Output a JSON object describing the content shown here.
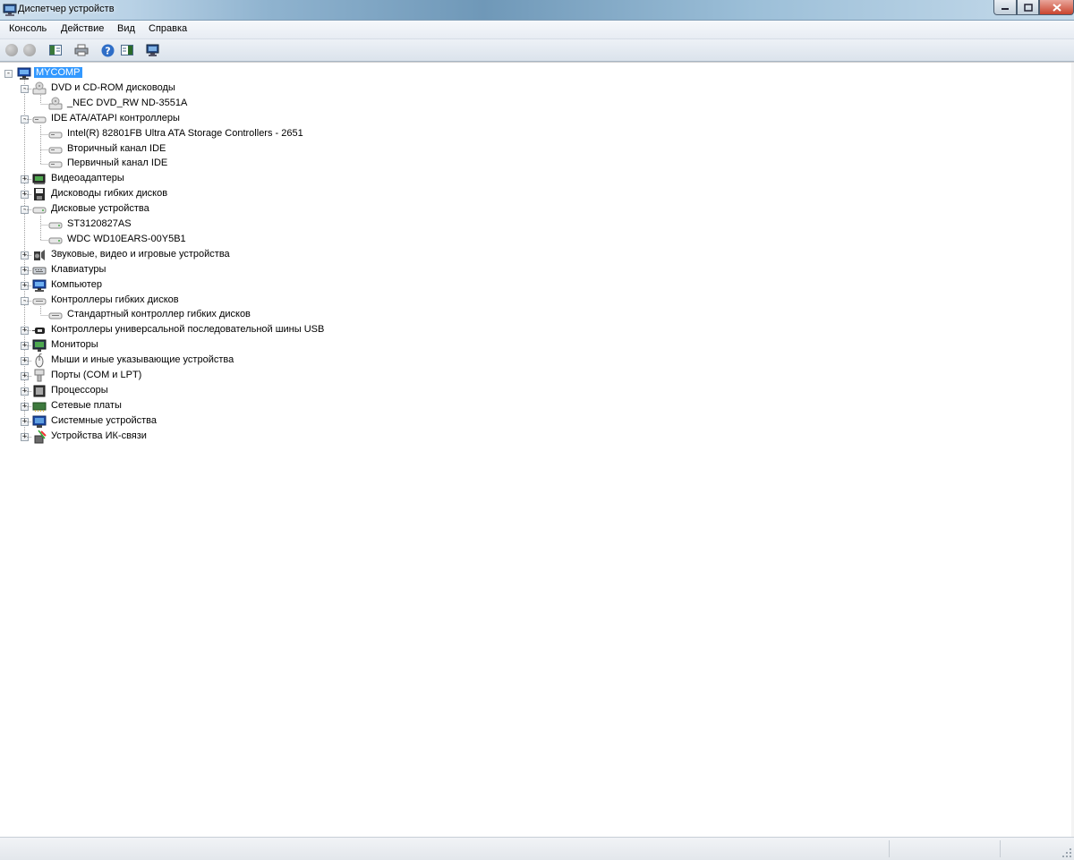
{
  "window": {
    "title": "Диспетчер устройств"
  },
  "menu": [
    "Консоль",
    "Действие",
    "Вид",
    "Справка"
  ],
  "toolbar": [
    "back-icon",
    "forward-icon",
    "show-hide-tree-icon",
    "print-icon",
    "help-icon",
    "action-pane-icon",
    "monitor-icon"
  ],
  "colors": {
    "selection": "#3399ff",
    "accent": "#6f98b8"
  },
  "tree": {
    "root": "MYCOMP",
    "nodes": [
      {
        "label": "DVD и CD-ROM дисководы",
        "level": 1,
        "expander": "-",
        "icon": "cdrom-icon"
      },
      {
        "label": "_NEC DVD_RW ND-3551A",
        "level": 2,
        "expander": "",
        "icon": "cdrom-icon"
      },
      {
        "label": "IDE ATA/ATAPI контроллеры",
        "level": 1,
        "expander": "-",
        "icon": "ide-controller-icon"
      },
      {
        "label": "Intel(R) 82801FB Ultra ATA Storage Controllers - 2651",
        "level": 2,
        "expander": "",
        "icon": "ide-controller-icon"
      },
      {
        "label": "Вторичный канал IDE",
        "level": 2,
        "expander": "",
        "icon": "ide-controller-icon"
      },
      {
        "label": "Первичный канал IDE",
        "level": 2,
        "expander": "",
        "icon": "ide-controller-icon"
      },
      {
        "label": "Видеоадаптеры",
        "level": 1,
        "expander": "+",
        "icon": "display-adapter-icon"
      },
      {
        "label": "Дисководы гибких дисков",
        "level": 1,
        "expander": "+",
        "icon": "floppy-icon"
      },
      {
        "label": "Дисковые устройства",
        "level": 1,
        "expander": "-",
        "icon": "disk-drive-icon"
      },
      {
        "label": "ST3120827AS",
        "level": 2,
        "expander": "",
        "icon": "disk-drive-icon"
      },
      {
        "label": "WDC WD10EARS-00Y5B1",
        "level": 2,
        "expander": "",
        "icon": "disk-drive-icon"
      },
      {
        "label": "Звуковые, видео и игровые устройства",
        "level": 1,
        "expander": "+",
        "icon": "speaker-icon"
      },
      {
        "label": "Клавиатуры",
        "level": 1,
        "expander": "+",
        "icon": "keyboard-icon"
      },
      {
        "label": "Компьютер",
        "level": 1,
        "expander": "+",
        "icon": "computer-icon"
      },
      {
        "label": "Контроллеры гибких дисков",
        "level": 1,
        "expander": "-",
        "icon": "floppy-controller-icon"
      },
      {
        "label": "Стандартный контроллер гибких дисков",
        "level": 2,
        "expander": "",
        "icon": "floppy-controller-icon"
      },
      {
        "label": "Контроллеры универсальной последовательной шины USB",
        "level": 1,
        "expander": "+",
        "icon": "usb-icon"
      },
      {
        "label": "Мониторы",
        "level": 1,
        "expander": "+",
        "icon": "monitor-icon"
      },
      {
        "label": "Мыши и иные указывающие устройства",
        "level": 1,
        "expander": "+",
        "icon": "mouse-icon"
      },
      {
        "label": "Порты (COM и LPT)",
        "level": 1,
        "expander": "+",
        "icon": "port-icon"
      },
      {
        "label": "Процессоры",
        "level": 1,
        "expander": "+",
        "icon": "processor-icon"
      },
      {
        "label": "Сетевые платы",
        "level": 1,
        "expander": "+",
        "icon": "network-adapter-icon"
      },
      {
        "label": "Системные устройства",
        "level": 1,
        "expander": "+",
        "icon": "system-device-icon"
      },
      {
        "label": "Устройства ИК-связи",
        "level": 1,
        "expander": "+",
        "icon": "infrared-icon"
      }
    ]
  }
}
